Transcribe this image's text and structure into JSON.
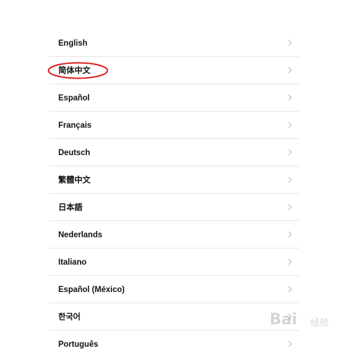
{
  "languages": [
    {
      "label": "English"
    },
    {
      "label": "简体中文"
    },
    {
      "label": "Español"
    },
    {
      "label": "Français"
    },
    {
      "label": "Deutsch"
    },
    {
      "label": "繁體中文"
    },
    {
      "label": "日本語"
    },
    {
      "label": "Nederlands"
    },
    {
      "label": "Italiano"
    },
    {
      "label": "Español (México)"
    },
    {
      "label": "한국어"
    },
    {
      "label": "Português"
    }
  ],
  "highlight": {
    "target": "简体中文",
    "color": "#e02020"
  },
  "watermark": {
    "text": "Bai",
    "sub": "经验"
  },
  "colors": {
    "text": "#111111",
    "divider": "#e6e6e6",
    "chevron": "#c7c7cc"
  }
}
